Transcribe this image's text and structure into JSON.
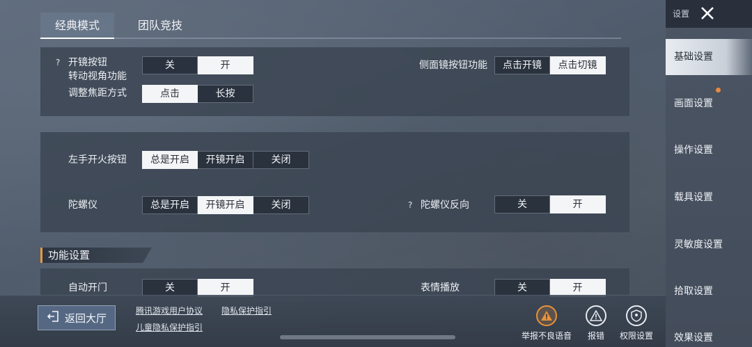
{
  "tabs": [
    {
      "label": "经典模式",
      "active": true
    },
    {
      "label": "团队竞技",
      "active": false
    }
  ],
  "scope_panel": {
    "scope_button_label_line1": "开镜按钮",
    "scope_button_label_line2": "转动视角功能",
    "scope_button_options": [
      "关",
      "开"
    ],
    "scope_button_selected": "开",
    "zoom_label": "调整焦距方式",
    "zoom_options": [
      "点击",
      "长按"
    ],
    "zoom_selected": "点击",
    "side_scope_label": "侧面镜按钮功能",
    "side_scope_options": [
      "点击开镜",
      "点击切镜"
    ],
    "side_scope_selected": "点击切镜"
  },
  "fire_panel": {
    "left_fire_label": "左手开火按钮",
    "left_fire_options": [
      "总是开启",
      "开镜开启",
      "关闭"
    ],
    "left_fire_selected": "总是开启",
    "gyro_label": "陀螺仪",
    "gyro_options": [
      "总是开启",
      "开镜开启",
      "关闭"
    ],
    "gyro_selected": "开镜开启",
    "gyro_reverse_label": "陀螺仪反向",
    "gyro_reverse_options": [
      "关",
      "开"
    ],
    "gyro_reverse_selected": "开"
  },
  "func_section": {
    "title": "功能设置",
    "auto_door_label": "自动开门",
    "auto_door_options": [
      "关",
      "开"
    ],
    "auto_door_selected": "开",
    "emote_label": "表情播放",
    "emote_options": [
      "关",
      "开"
    ],
    "emote_selected": "开"
  },
  "bottom_bar": {
    "back_label": "返回大厅",
    "links": [
      "腾讯游戏用户协议",
      "隐私保护指引",
      "儿童隐私保护指引"
    ],
    "actions": [
      {
        "label": "举报不良语音",
        "icon": "warning-icon"
      },
      {
        "label": "报错",
        "icon": "alert-icon"
      },
      {
        "label": "权限设置",
        "icon": "permission-shield-icon"
      }
    ]
  },
  "sidebar": {
    "title": "设置",
    "items": [
      {
        "label": "基础设置",
        "active": true
      },
      {
        "label": "画面设置",
        "active": false,
        "badge": true
      },
      {
        "label": "操作设置",
        "active": false
      },
      {
        "label": "载具设置",
        "active": false
      },
      {
        "label": "灵敏度设置",
        "active": false
      },
      {
        "label": "拾取设置",
        "active": false
      },
      {
        "label": "效果设置",
        "active": false
      }
    ]
  },
  "colors": {
    "accent": "#e8923a",
    "selected_bg": "#f3f5f7",
    "panel_bg": "#3a4452"
  }
}
